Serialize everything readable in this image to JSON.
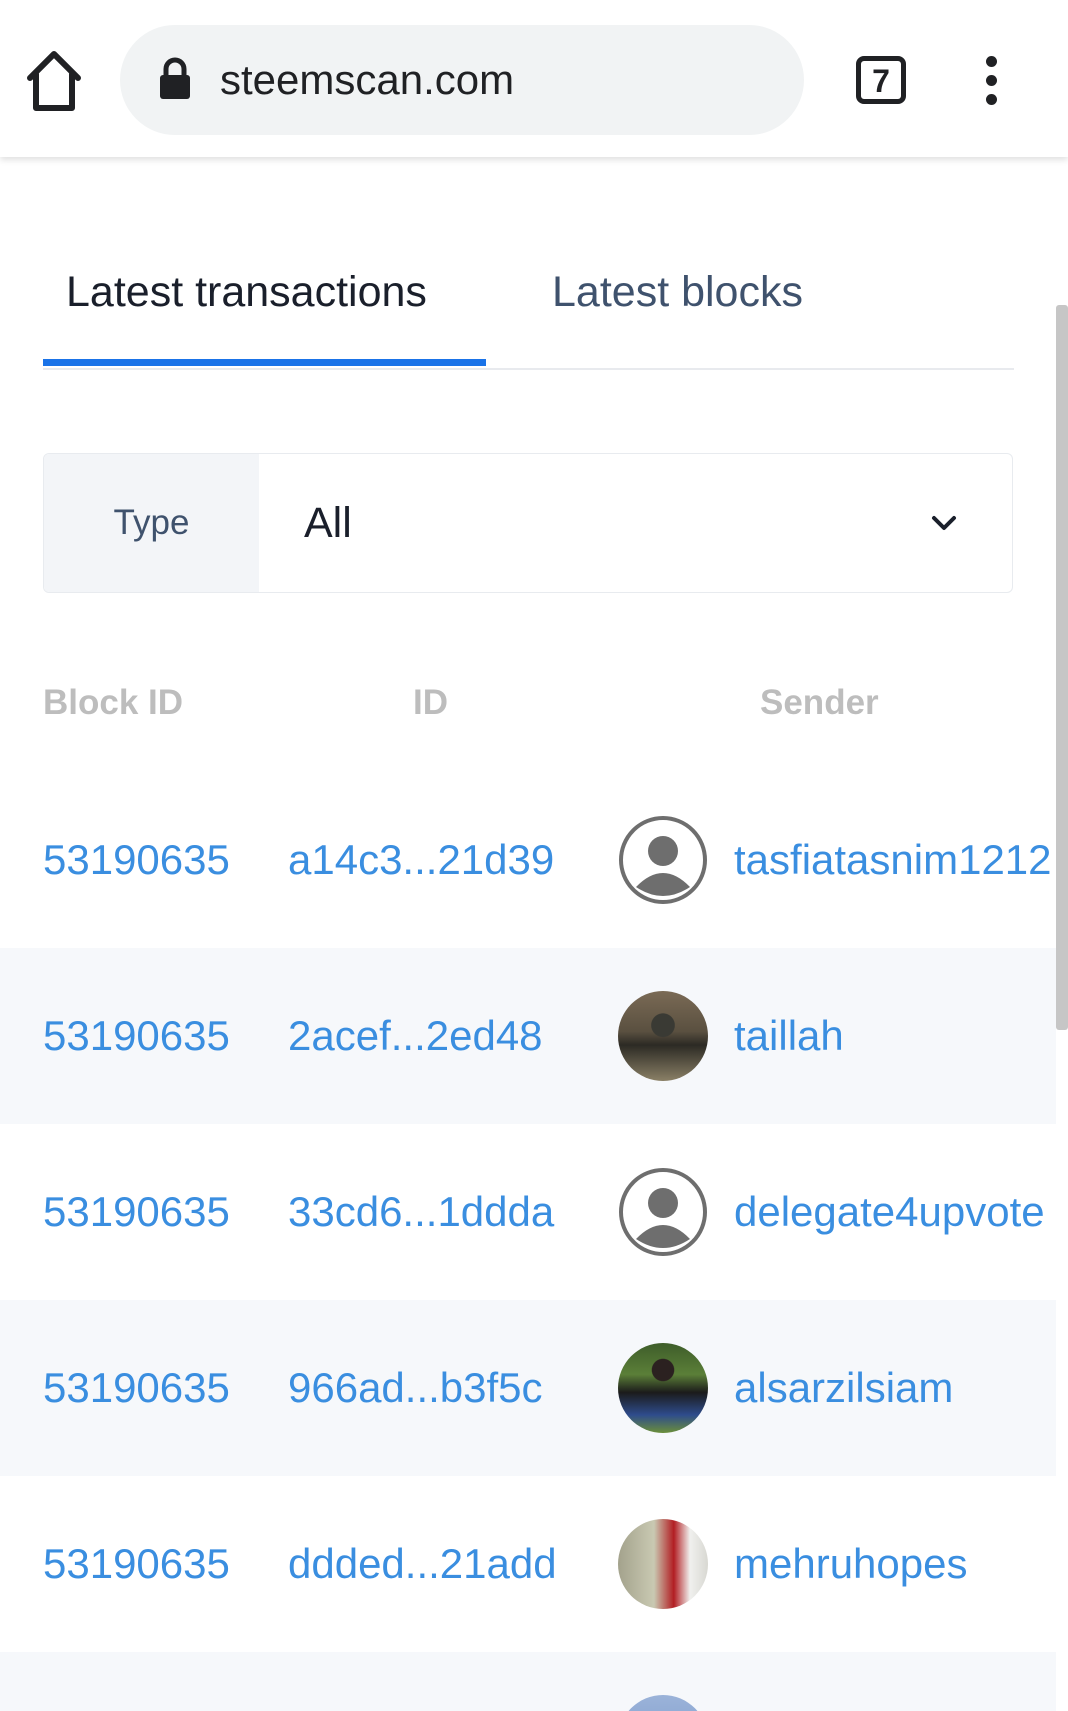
{
  "browser": {
    "url": "steemscan.com",
    "tab_count": "7"
  },
  "tabs": [
    {
      "label": "Latest transactions",
      "active": true
    },
    {
      "label": "Latest blocks",
      "active": false
    }
  ],
  "filter": {
    "label": "Type",
    "value": "All"
  },
  "table": {
    "headers": [
      "Block ID",
      "ID",
      "Sender"
    ],
    "rows": [
      {
        "block_id": "53190635",
        "id": "a14c3...21d39",
        "sender": "tasfiatasnim1212",
        "avatar": "default-avatar"
      },
      {
        "block_id": "53190635",
        "id": "2acef...2ed48",
        "sender": "taillah",
        "avatar": "photo"
      },
      {
        "block_id": "53190635",
        "id": "33cd6...1ddda",
        "sender": "delegate4upvote",
        "avatar": "default-avatar"
      },
      {
        "block_id": "53190635",
        "id": "966ad...b3f5c",
        "sender": "alsarzilsiam",
        "avatar": "photo"
      },
      {
        "block_id": "53190635",
        "id": "ddded...21add",
        "sender": "mehruhopes",
        "avatar": "photo"
      }
    ]
  },
  "colors": {
    "link": "#3a8ee0",
    "accent": "#1a73e8",
    "row_alt_bg": "#f6f8fb",
    "header_text": "#bdbdbd"
  }
}
